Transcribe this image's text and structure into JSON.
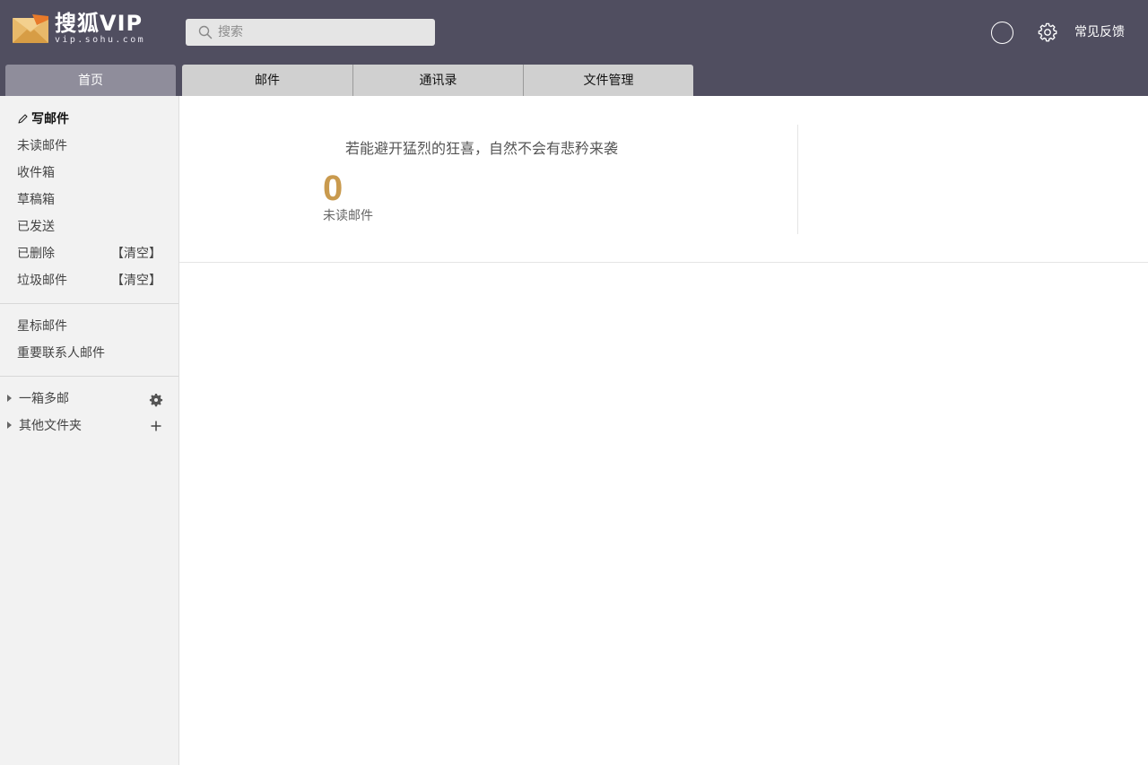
{
  "header": {
    "logo": {
      "brand": "搜狐VIP",
      "sub": "vip.sohu.com"
    },
    "search": {
      "placeholder": "搜索",
      "value": ""
    },
    "feedback_label": "常见反馈",
    "tabs": [
      {
        "label": "首页",
        "active": true
      },
      {
        "label": "邮件",
        "active": false
      },
      {
        "label": "通讯录",
        "active": false
      },
      {
        "label": "文件管理",
        "active": false
      }
    ]
  },
  "sidebar": {
    "compose_label": "写邮件",
    "folders": [
      {
        "label": "未读邮件"
      },
      {
        "label": "收件箱"
      },
      {
        "label": "草稿箱"
      },
      {
        "label": "已发送"
      },
      {
        "label": "已删除",
        "action": "【清空】"
      },
      {
        "label": "垃圾邮件",
        "action": "【清空】"
      }
    ],
    "special": [
      {
        "label": "星标邮件"
      },
      {
        "label": "重要联系人邮件"
      }
    ],
    "groups": [
      {
        "label": "一箱多邮",
        "icon": "gear-icon"
      },
      {
        "label": "其他文件夹",
        "icon": "plus-icon"
      }
    ]
  },
  "main": {
    "quote": "若能避开猛烈的狂喜，自然不会有悲矜来袭",
    "unread_count": "0",
    "unread_label": "未读邮件"
  },
  "colors": {
    "header_bg": "#504e60",
    "active_tab": "#8f8d9b",
    "tab_bg": "#d0d0d0",
    "sidebar_bg": "#f2f2f2",
    "unread_accent": "#c99a4e"
  }
}
